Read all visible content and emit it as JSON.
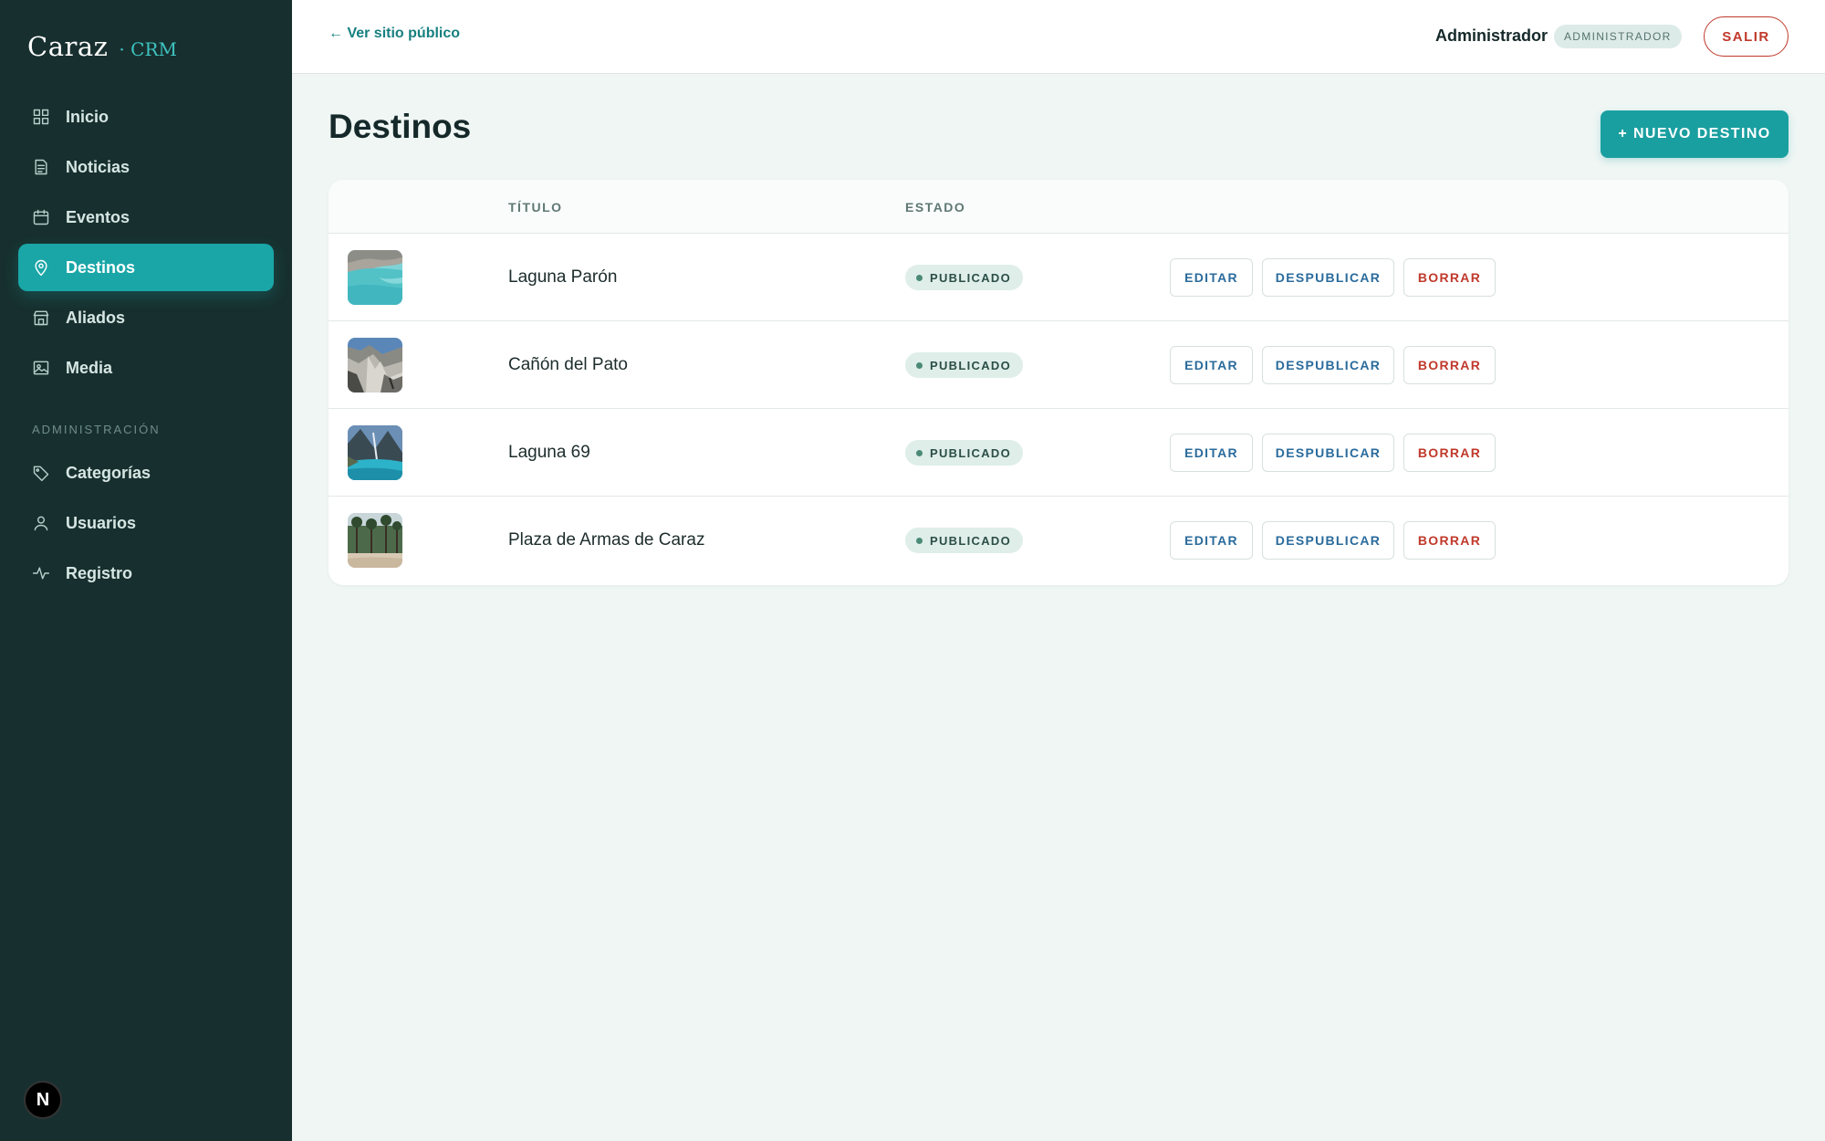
{
  "sidebar": {
    "brand_name": "Caraz",
    "brand_suffix": "· CRM",
    "items": [
      {
        "label": "Inicio",
        "icon": "grid-icon"
      },
      {
        "label": "Noticias",
        "icon": "document-icon"
      },
      {
        "label": "Eventos",
        "icon": "calendar-icon"
      },
      {
        "label": "Destinos",
        "icon": "map-pin-icon",
        "active": true
      },
      {
        "label": "Aliados",
        "icon": "store-icon"
      },
      {
        "label": "Media",
        "icon": "image-icon"
      }
    ],
    "admin_section_label": "ADMINISTRACIÓN",
    "admin_items": [
      {
        "label": "Categorías",
        "icon": "tag-icon"
      },
      {
        "label": "Usuarios",
        "icon": "user-icon"
      },
      {
        "label": "Registro",
        "icon": "activity-icon"
      }
    ],
    "dev_badge": "N"
  },
  "topbar": {
    "back_link": "← Ver sitio público",
    "user_name": "Administrador",
    "role_badge": "ADMINISTRADOR",
    "logout_label": "SALIR"
  },
  "main": {
    "page_title": "Destinos",
    "new_button_label": "+ NUEVO DESTINO",
    "table": {
      "headers": {
        "title": "TÍTULO",
        "status": "ESTADO"
      },
      "rows": [
        {
          "title": "Laguna Parón",
          "status": "PUBLICADO",
          "thumb": "turquoise-lake"
        },
        {
          "title": "Cañón del Pato",
          "status": "PUBLICADO",
          "thumb": "rocky-canyon"
        },
        {
          "title": "Laguna 69",
          "status": "PUBLICADO",
          "thumb": "mountain-lake"
        },
        {
          "title": "Plaza de Armas de Caraz",
          "status": "PUBLICADO",
          "thumb": "plaza-palms"
        }
      ],
      "actions": {
        "edit": "EDITAR",
        "unpublish": "DESPUBLICAR",
        "delete": "BORRAR"
      }
    }
  },
  "colors": {
    "sidebar_bg": "#17302f",
    "accent": "#1aa6a7",
    "danger": "#c0392b",
    "link_blue": "#2a6b9c",
    "page_bg": "#eff6f4"
  }
}
